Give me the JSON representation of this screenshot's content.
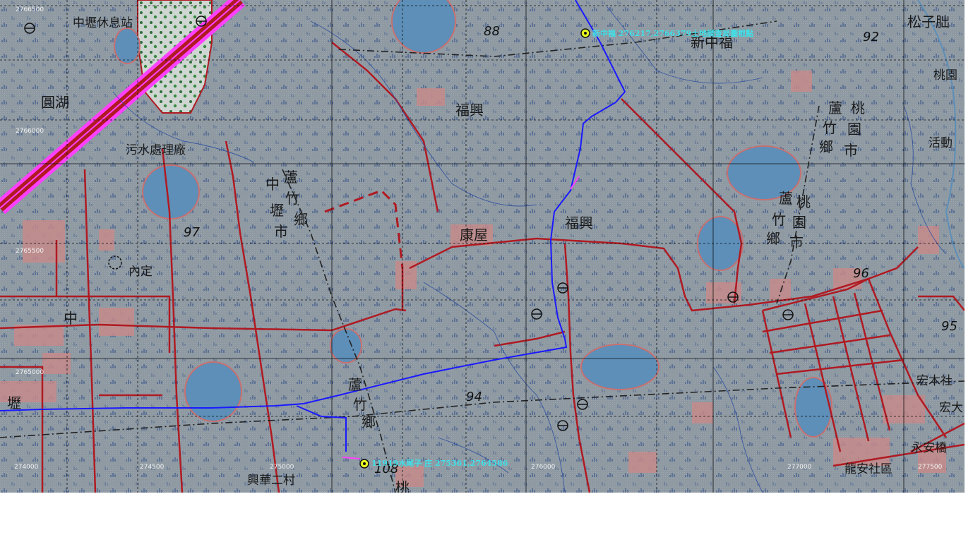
{
  "map": {
    "grid_labels": {
      "n2766500": "2766500",
      "n2766000": "2766000",
      "n2765500": "2765500",
      "n2765000": "2765000",
      "e274000": "274000",
      "e274500": "274500",
      "e275000": "275000",
      "e276000": "276000",
      "e277000": "277000",
      "e277500": "277500"
    },
    "places": {
      "zhongli_rest": "中壢休息站",
      "yuanhu": "圓湖",
      "sewage": "污水處理廠",
      "fuxing_n": "福興",
      "fuxing_c": "福興",
      "kangwu": "康屋",
      "neiding": "內定",
      "zhong": "中",
      "xinzhongfu": "新中福",
      "songzipi": "松子朏",
      "taoyuan_edge": "桃園",
      "huodong": "活動",
      "hongmu": "宏木社",
      "hongda": "宏大",
      "yongan": "永安橋",
      "longan": "龍安社區",
      "xinghua": "興華二村",
      "zhongli_c": "中",
      "bo": "壢",
      "lu_l": "蘆",
      "zhu_l": "竹",
      "shi_l": "市",
      "xiang_l": "鄉",
      "lu_c": "蘆",
      "zhu_c": "竹",
      "xiang_c": "鄉",
      "lu_r1": "蘆",
      "tao_r1": "桃",
      "zhu_r1": "竹",
      "yuan_r1": "園",
      "xiang_r1": "鄉",
      "shi_r1": "市",
      "lu_r2": "蘆",
      "tao_r2": "桃",
      "zhu_r2": "竹",
      "yuan_r2": "園",
      "xiang_r2": "鄉",
      "shi_r2": "市",
      "bo_left": "壢",
      "tao_bottom": "桃"
    },
    "elevations": {
      "e88": "88",
      "e92": "92",
      "e97": "97",
      "e96": "96",
      "e95": "95",
      "e94": "94",
      "e108": "108"
    },
    "pois": {
      "north_label": "新中福 276217,2766379土地調查局圖根點",
      "south_label": "11919水尾子 庄 275361,2764586"
    },
    "colors": {
      "background": "#8f9aa3",
      "road": "#b01a22",
      "river": "#2b4bd8",
      "pond": "#5d8fb8",
      "urban": "#c98a8a",
      "highway": "#ff40ff",
      "route": "#1a1aff"
    }
  }
}
